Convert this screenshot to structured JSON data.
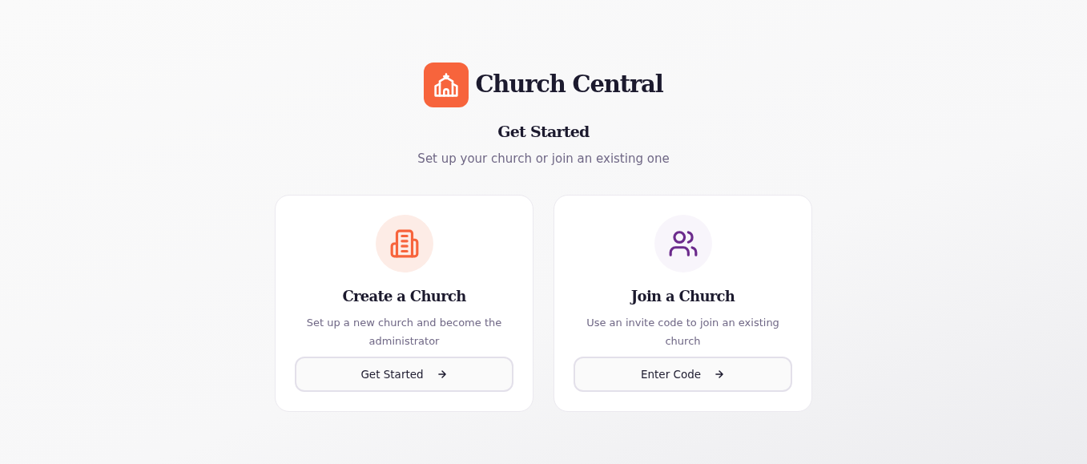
{
  "brand": {
    "name": "Church Central"
  },
  "heading": "Get Started",
  "subtitle": "Set up your church or join an existing one",
  "options": [
    {
      "kind": "create",
      "title": "Create a Church",
      "description": "Set up a new church and become the administrator",
      "button": "Get Started"
    },
    {
      "kind": "join",
      "title": "Join a Church",
      "description": "Use an invite code to join an existing church",
      "button": "Enter Code"
    }
  ]
}
